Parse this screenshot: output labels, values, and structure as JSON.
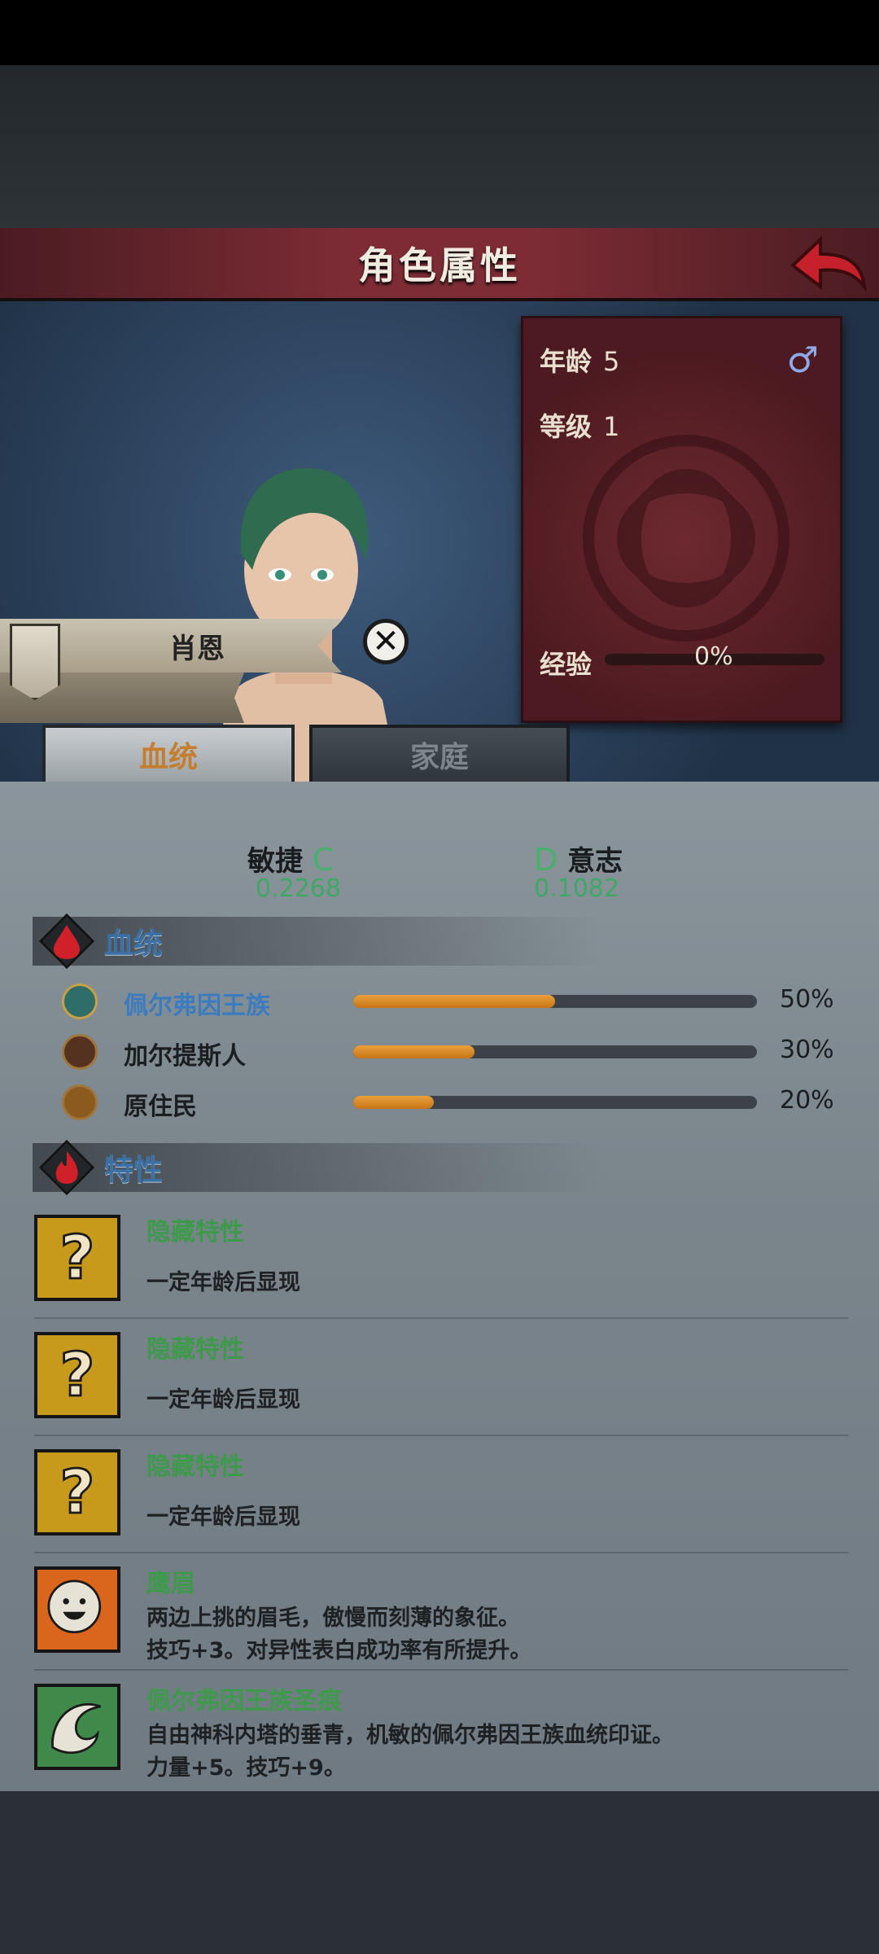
{
  "header": {
    "title": "角色属性"
  },
  "profile": {
    "name": "肖恩",
    "age_label": "年龄",
    "age_value": "5",
    "level_label": "等级",
    "level_value": "1",
    "gender_symbol": "♂",
    "exp_label": "经验",
    "exp_value": "0%",
    "exp_fraction": 0
  },
  "tabs": [
    {
      "label": "血统",
      "active": true
    },
    {
      "label": "家庭",
      "active": false
    }
  ],
  "attributes": {
    "left": {
      "name": "敏捷",
      "grade": "C",
      "value": "0.2268"
    },
    "right": {
      "name": "意志",
      "grade": "D",
      "value": "0.1082"
    }
  },
  "lineage": {
    "title": "血统",
    "items": [
      {
        "name": "佩尔弗因王族",
        "percent": "50%",
        "fraction": 0.5,
        "icon": "crown-emblem-icon"
      },
      {
        "name": "加尔提斯人",
        "percent": "30%",
        "fraction": 0.3,
        "icon": "beast-emblem-icon"
      },
      {
        "name": "原住民",
        "percent": "20%",
        "fraction": 0.2,
        "icon": "leaf-emblem-icon"
      }
    ]
  },
  "traits": {
    "title": "特性",
    "items": [
      {
        "name": "隐藏特性",
        "desc1": "一定年龄后显现",
        "desc2": "",
        "icon": "question-mark-icon"
      },
      {
        "name": "隐藏特性",
        "desc1": "一定年龄后显现",
        "desc2": "",
        "icon": "question-mark-icon"
      },
      {
        "name": "隐藏特性",
        "desc1": "一定年龄后显现",
        "desc2": "",
        "icon": "question-mark-icon"
      },
      {
        "name": "鹰眉",
        "desc1": "两边上挑的眉毛，傲慢而刻薄的象征。",
        "desc2": "技巧+3。对异性表白成功率有所提升。",
        "icon": "smiling-face-icon"
      },
      {
        "name": "佩尔弗因王族圣痕",
        "desc1": "自由神科内塔的垂青，机敏的佩尔弗因王族血统印证。",
        "desc2": "力量+5。技巧+9。",
        "icon": "wave-mark-icon"
      }
    ]
  },
  "colors": {
    "accent_tab": "#c57d2e",
    "trait_name": "#3e9a4b",
    "bar_fill": "#e9a03a",
    "banner": "#7d2c35"
  }
}
